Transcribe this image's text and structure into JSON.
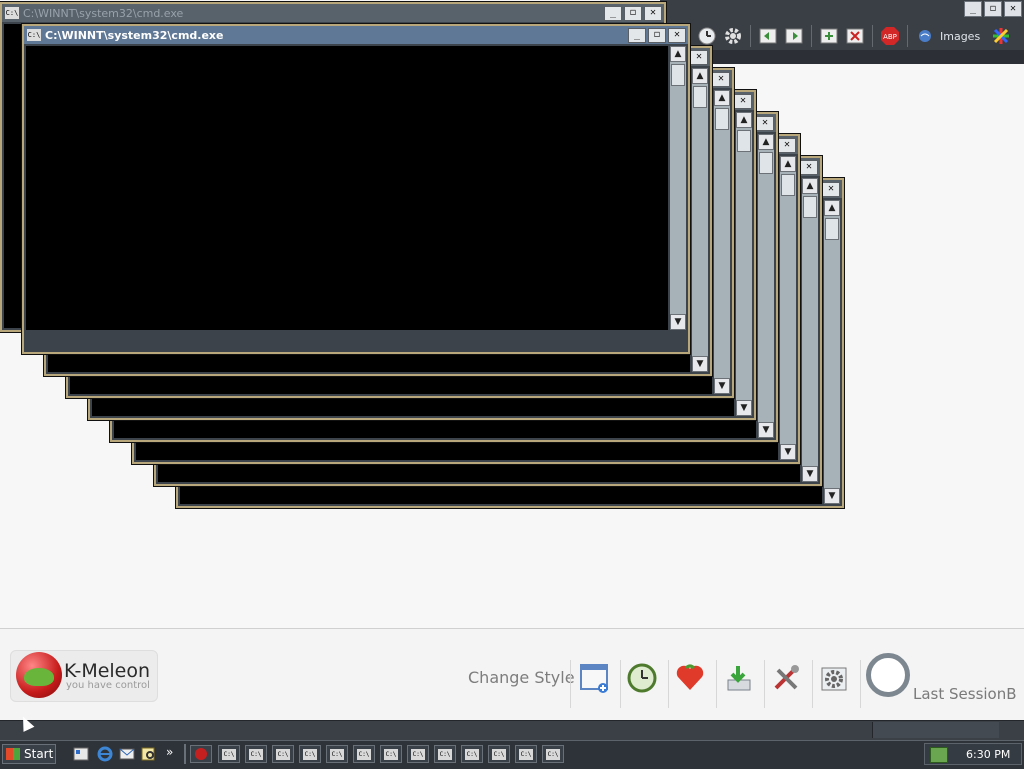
{
  "browser": {
    "title_buttons": [
      "_",
      "◻",
      "✕"
    ],
    "toolbar_images_label": "Images"
  },
  "window": {
    "icon_label": "C:\\",
    "title": "C:\\WINNT\\system32\\cmd.exe",
    "buttons": [
      "_",
      "◻",
      "✕"
    ]
  },
  "footer": {
    "logo_name": "K-Meleon",
    "logo_tagline": "you have control",
    "change_style": "Change Style",
    "last_session": "Last SessionB"
  },
  "taskbar": {
    "start_label": "Start",
    "overflow": "»",
    "task_icon_label": "C:\\",
    "clock": "6:30 PM"
  },
  "colors": {
    "active_titlebar": "#5f7896",
    "inactive_titlebar": "#58626b",
    "window_border": "#b7a77b"
  }
}
